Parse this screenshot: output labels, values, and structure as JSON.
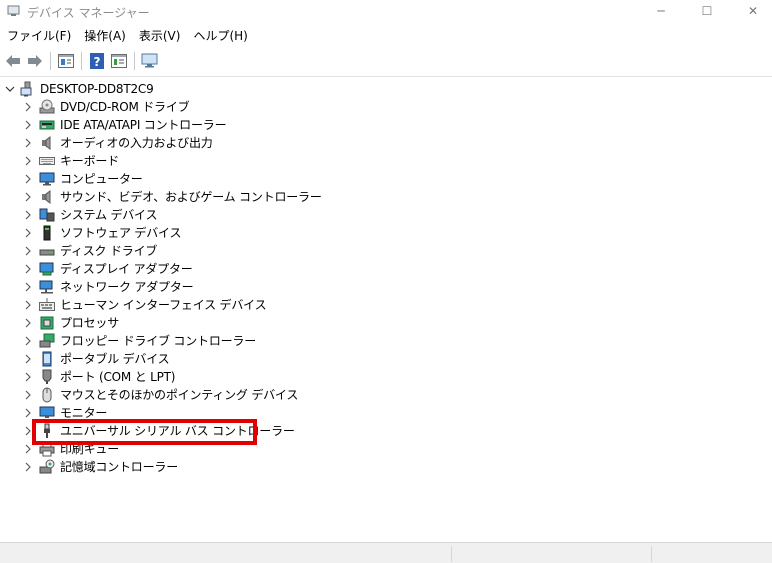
{
  "window": {
    "title": "デバイス マネージャー",
    "minimize_glyph": "─",
    "maximize_glyph": "☐",
    "close_glyph": "✕"
  },
  "menu": {
    "items": [
      "ファイル(F)",
      "操作(A)",
      "表示(V)",
      "ヘルプ(H)"
    ]
  },
  "toolbar": {
    "buttons": [
      "back-icon",
      "forward-icon",
      "properties-icon",
      "help-icon",
      "view-icon",
      "monitor-scan-icon"
    ]
  },
  "tree": {
    "root": {
      "label": "DESKTOP-DD8T2C9",
      "icon": "computer-icon"
    },
    "items": [
      {
        "label": "DVD/CD-ROM ドライブ",
        "icon": "dvd-icon"
      },
      {
        "label": "IDE ATA/ATAPI コントローラー",
        "icon": "ide-icon"
      },
      {
        "label": "オーディオの入力および出力",
        "icon": "speaker-icon"
      },
      {
        "label": "キーボード",
        "icon": "keyboard-icon"
      },
      {
        "label": "コンピューター",
        "icon": "computer-monitor-icon"
      },
      {
        "label": "サウンド、ビデオ、およびゲーム コントローラー",
        "icon": "speaker-icon"
      },
      {
        "label": "システム デバイス",
        "icon": "system-device-icon"
      },
      {
        "label": "ソフトウェア デバイス",
        "icon": "software-device-icon"
      },
      {
        "label": "ディスク ドライブ",
        "icon": "disk-drive-icon"
      },
      {
        "label": "ディスプレイ アダプター",
        "icon": "display-adapter-icon"
      },
      {
        "label": "ネットワーク アダプター",
        "icon": "network-adapter-icon"
      },
      {
        "label": "ヒューマン インターフェイス デバイス",
        "icon": "hid-icon"
      },
      {
        "label": "プロセッサ",
        "icon": "processor-icon"
      },
      {
        "label": "フロッピー ドライブ コントローラー",
        "icon": "floppy-controller-icon"
      },
      {
        "label": "ポータブル デバイス",
        "icon": "portable-device-icon"
      },
      {
        "label": "ポート (COM と LPT)",
        "icon": "port-icon"
      },
      {
        "label": "マウスとそのほかのポインティング デバイス",
        "icon": "mouse-icon"
      },
      {
        "label": "モニター",
        "icon": "monitor-icon"
      },
      {
        "label": "ユニバーサル シリアル バス コントローラー",
        "icon": "usb-icon"
      },
      {
        "label": "印刷キュー",
        "icon": "printer-icon"
      },
      {
        "label": "記憶域コントローラー",
        "icon": "storage-controller-icon"
      }
    ]
  },
  "highlight_color": "#e00000"
}
